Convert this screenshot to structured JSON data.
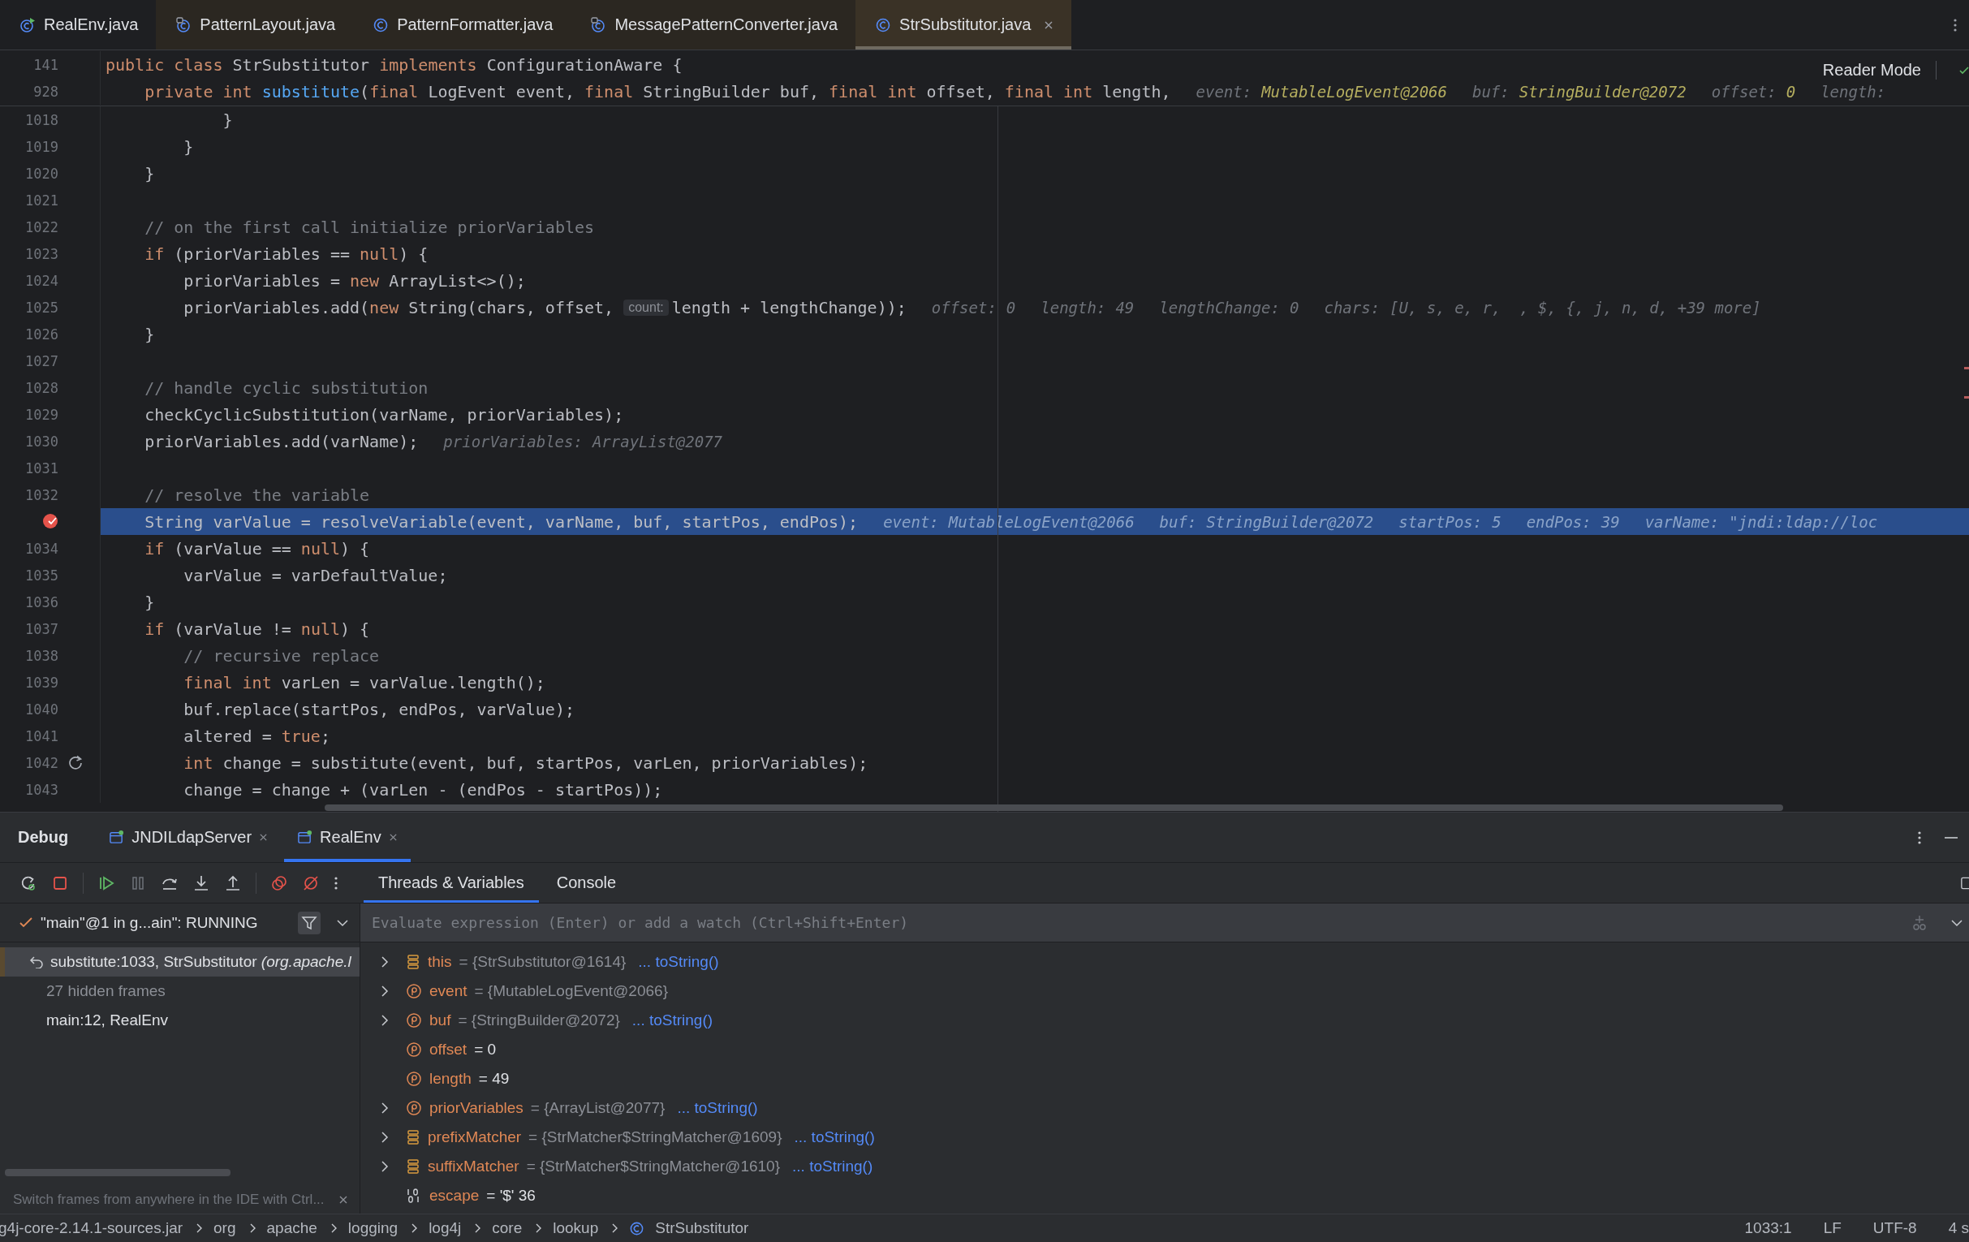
{
  "editor_tabs": [
    {
      "label": "RealEnv.java",
      "kind": "runnable",
      "library": false,
      "selected": false,
      "closable": false
    },
    {
      "label": "PatternLayout.java",
      "kind": "plugin",
      "library": true,
      "selected": false,
      "closable": false
    },
    {
      "label": "PatternFormatter.java",
      "kind": "class",
      "library": true,
      "selected": false,
      "closable": false
    },
    {
      "label": "MessagePatternConverter.java",
      "kind": "plugin",
      "library": true,
      "selected": false,
      "closable": false
    },
    {
      "label": "StrSubstitutor.java",
      "kind": "class",
      "library": true,
      "selected": true,
      "closable": true
    }
  ],
  "reader_mode": "Reader Mode",
  "sticky_lines": [
    {
      "number": "141",
      "tokens": [
        {
          "kind": "kw",
          "text": "public class "
        },
        {
          "kind": "tx",
          "text": "StrSubstitutor "
        },
        {
          "kind": "kw",
          "text": "implements "
        },
        {
          "kind": "tx",
          "text": "ConfigurationAware {"
        }
      ]
    },
    {
      "number": "928",
      "tokens": [
        {
          "kind": "kw",
          "text": "    private int "
        },
        {
          "kind": "fn",
          "text": "substitute"
        },
        {
          "kind": "tx",
          "text": "("
        },
        {
          "kind": "kw",
          "text": "final "
        },
        {
          "kind": "tx",
          "text": "LogEvent event, "
        },
        {
          "kind": "kw",
          "text": "final "
        },
        {
          "kind": "tx",
          "text": "StringBuilder buf, "
        },
        {
          "kind": "kw",
          "text": "final int "
        },
        {
          "kind": "tx",
          "text": "offset, "
        },
        {
          "kind": "kw",
          "text": "final int "
        },
        {
          "kind": "tx",
          "text": "length,"
        }
      ],
      "hints": [
        {
          "name": "event:",
          "value": "MutableLogEvent@2066"
        },
        {
          "name": "buf:",
          "value": "StringBuilder@2072"
        },
        {
          "name": "offset:",
          "value": "0"
        },
        {
          "name": "length:"
        }
      ]
    }
  ],
  "lines": [
    {
      "number": "1018",
      "selected": false,
      "tokens": [
        {
          "kind": "tx",
          "text": "            }"
        }
      ]
    },
    {
      "number": "1019",
      "selected": false,
      "tokens": [
        {
          "kind": "tx",
          "text": "        }"
        }
      ]
    },
    {
      "number": "1020",
      "selected": false,
      "tokens": [
        {
          "kind": "tx",
          "text": "    }"
        }
      ]
    },
    {
      "number": "1021",
      "selected": false
    },
    {
      "number": "1022",
      "selected": false,
      "tokens": [
        {
          "kind": "cm",
          "text": "    // on the first call initialize priorVariables"
        }
      ]
    },
    {
      "number": "1023",
      "selected": false,
      "tokens": [
        {
          "kind": "kw",
          "text": "    if "
        },
        {
          "kind": "tx",
          "text": "(priorVariables == "
        },
        {
          "kind": "kw",
          "text": "null"
        },
        {
          "kind": "tx",
          "text": ") {"
        }
      ]
    },
    {
      "number": "1024",
      "selected": false,
      "tokens": [
        {
          "kind": "tx",
          "text": "        priorVariables = "
        },
        {
          "kind": "kw",
          "text": "new "
        },
        {
          "kind": "tx",
          "text": "ArrayList<>();"
        }
      ]
    },
    {
      "number": "1025",
      "selected": false,
      "tokens": [
        {
          "kind": "tx",
          "text": "        priorVariables.add("
        },
        {
          "kind": "kw",
          "text": "new "
        },
        {
          "kind": "tx",
          "text": "String(chars, offset, "
        },
        {
          "kind": "hint",
          "text": "count:"
        },
        {
          "kind": "tx",
          "text": "length + lengthChange));"
        }
      ],
      "hints": [
        {
          "name": "offset:",
          "value": "0"
        },
        {
          "name": "length:",
          "value": "49"
        },
        {
          "name": "lengthChange:",
          "value": "0"
        },
        {
          "name": "chars:",
          "value": "[U, s, e, r,  , $, {, j, n, d, +39 more]"
        }
      ]
    },
    {
      "number": "1026",
      "selected": false,
      "tokens": [
        {
          "kind": "tx",
          "text": "    }"
        }
      ]
    },
    {
      "number": "1027",
      "selected": false
    },
    {
      "number": "1028",
      "selected": false,
      "tokens": [
        {
          "kind": "cm",
          "text": "    // handle cyclic substitution"
        }
      ]
    },
    {
      "number": "1029",
      "selected": false,
      "tokens": [
        {
          "kind": "tx",
          "text": "    checkCyclicSubstitution(varName, priorVariables);"
        }
      ]
    },
    {
      "number": "1030",
      "selected": false,
      "tokens": [
        {
          "kind": "tx",
          "text": "    priorVariables.add(varName);"
        }
      ],
      "hints": [
        {
          "name": "priorVariables:",
          "value": "ArrayList@2077"
        }
      ]
    },
    {
      "number": "1031",
      "selected": false
    },
    {
      "number": "1032",
      "selected": false,
      "tokens": [
        {
          "kind": "cm",
          "text": "    // resolve the variable"
        }
      ]
    },
    {
      "kind": "breakpoint",
      "selected": true,
      "tokens": [
        {
          "kind": "tx",
          "text": "    String varValue = resolveVariable(event, varName, buf, startPos, endPos);"
        }
      ],
      "hints": [
        {
          "name": "event:",
          "value": "MutableLogEvent@2066"
        },
        {
          "name": "buf:",
          "value": "StringBuilder@2072"
        },
        {
          "name": "startPos:",
          "value": "5"
        },
        {
          "name": "endPos:",
          "value": "39"
        },
        {
          "name": "varName:",
          "value": "\"jndi:ldap://loc"
        }
      ]
    },
    {
      "number": "1034",
      "selected": false,
      "tokens": [
        {
          "kind": "kw",
          "text": "    if "
        },
        {
          "kind": "tx",
          "text": "(varValue == "
        },
        {
          "kind": "kw",
          "text": "null"
        },
        {
          "kind": "tx",
          "text": ") {"
        }
      ]
    },
    {
      "number": "1035",
      "selected": false,
      "tokens": [
        {
          "kind": "tx",
          "text": "        varValue = varDefaultValue;"
        }
      ]
    },
    {
      "number": "1036",
      "selected": false,
      "tokens": [
        {
          "kind": "tx",
          "text": "    }"
        }
      ]
    },
    {
      "number": "1037",
      "selected": false,
      "tokens": [
        {
          "kind": "kw",
          "text": "    if "
        },
        {
          "kind": "tx",
          "text": "(varValue != "
        },
        {
          "kind": "kw",
          "text": "null"
        },
        {
          "kind": "tx",
          "text": ") {"
        }
      ]
    },
    {
      "number": "1038",
      "selected": false,
      "tokens": [
        {
          "kind": "cm",
          "text": "        // recursive replace"
        }
      ]
    },
    {
      "number": "1039",
      "selected": false,
      "tokens": [
        {
          "kind": "kw",
          "text": "        final int "
        },
        {
          "kind": "tx",
          "text": "varLen = varValue.length();"
        }
      ]
    },
    {
      "number": "1040",
      "selected": false,
      "tokens": [
        {
          "kind": "tx",
          "text": "        buf.replace(startPos, endPos, varValue);"
        }
      ]
    },
    {
      "number": "1041",
      "selected": false,
      "tokens": [
        {
          "kind": "tx",
          "text": "        altered = "
        },
        {
          "kind": "kw",
          "text": "true"
        },
        {
          "kind": "tx",
          "text": ";"
        }
      ]
    },
    {
      "number": "1042",
      "kind": "recursion",
      "selected": false,
      "tokens": [
        {
          "kind": "kw",
          "text": "        int "
        },
        {
          "kind": "tx",
          "text": "change = substitute(event, buf, startPos, varLen, priorVariables);"
        }
      ]
    },
    {
      "number": "1043",
      "selected": false,
      "tokens": [
        {
          "kind": "tx",
          "text": "        change = change + (varLen - (endPos - startPos));"
        }
      ]
    }
  ],
  "debug": {
    "title": "Debug",
    "sessions": [
      {
        "label": "JNDILdapServer",
        "selected": false
      },
      {
        "label": "RealEnv",
        "selected": true
      }
    ],
    "view_tabs": [
      {
        "label": "Threads & Variables",
        "selected": true
      },
      {
        "label": "Console",
        "selected": false
      }
    ],
    "thread": "\"main\"@1 in g...ain\": RUNNING",
    "frames": [
      {
        "kind": "current",
        "text": "substitute:1033, StrSubstitutor *(org.apache.l*",
        "selected": true
      },
      {
        "kind": "hidden",
        "text": "27 hidden frames",
        "selected": false
      },
      {
        "kind": "frame",
        "text": "main:12, RealEnv",
        "selected": false
      }
    ],
    "frames_hint": "Switch frames from anywhere in the IDE with Ctrl...",
    "evaluate_placeholder": "Evaluate expression (Enter) or add a watch (Ctrl+Shift+Enter)",
    "variables": [
      {
        "kind": "field",
        "name": "this",
        "value": "= {StrSubstitutor@1614}",
        "object": true,
        "link": "... toString()",
        "expandable": true
      },
      {
        "kind": "param",
        "name": "event",
        "value": "= {MutableLogEvent@2066}",
        "object": true,
        "expandable": true
      },
      {
        "kind": "param",
        "name": "buf",
        "value": "= {StringBuilder@2072}",
        "object": true,
        "link": "... toString()",
        "expandable": true
      },
      {
        "kind": "param",
        "name": "offset",
        "value": "= 0",
        "object": false,
        "expandable": false
      },
      {
        "kind": "param",
        "name": "length",
        "value": "= 49",
        "object": false,
        "expandable": false
      },
      {
        "kind": "param",
        "name": "priorVariables",
        "value": "= {ArrayList@2077}",
        "object": true,
        "link": "... toString()",
        "expandable": true
      },
      {
        "kind": "field",
        "name": "prefixMatcher",
        "value": "= {StrMatcher$StringMatcher@1609}",
        "object": true,
        "link": "... toString()",
        "expandable": true
      },
      {
        "kind": "field",
        "name": "suffixMatcher",
        "value": "= {StrMatcher$StringMatcher@1610}",
        "object": true,
        "link": "... toString()",
        "expandable": true
      },
      {
        "kind": "primitive",
        "name": "escape",
        "value": "= '$' 36",
        "object": false,
        "expandable": false
      }
    ]
  },
  "status_bar": {
    "breadcrumbs": [
      "g4j-core-2.14.1-sources.jar",
      "org",
      "apache",
      "logging",
      "log4j",
      "core",
      "lookup",
      "StrSubstitutor"
    ],
    "info": [
      "1033:1",
      "LF",
      "UTF-8",
      "4 s"
    ]
  }
}
